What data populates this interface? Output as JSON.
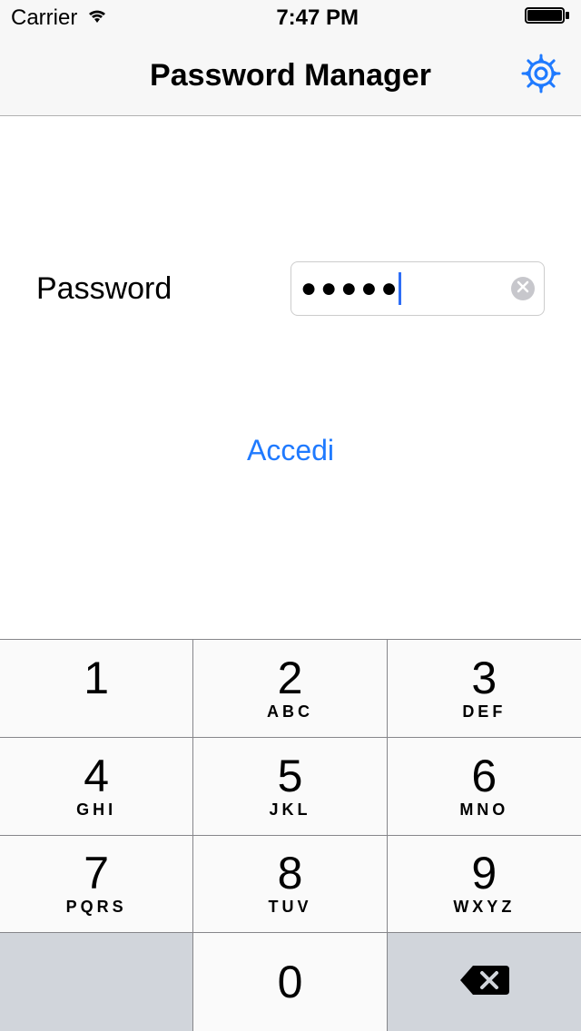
{
  "status_bar": {
    "carrier": "Carrier",
    "time": "7:47 PM"
  },
  "nav": {
    "title": "Password Manager"
  },
  "form": {
    "password_label": "Password",
    "password_value": "●●●●●"
  },
  "actions": {
    "login_label": "Accedi"
  },
  "keypad": {
    "keys": [
      {
        "digit": "1",
        "letters": ""
      },
      {
        "digit": "2",
        "letters": "ABC"
      },
      {
        "digit": "3",
        "letters": "DEF"
      },
      {
        "digit": "4",
        "letters": "GHI"
      },
      {
        "digit": "5",
        "letters": "JKL"
      },
      {
        "digit": "6",
        "letters": "MNO"
      },
      {
        "digit": "7",
        "letters": "PQRS"
      },
      {
        "digit": "8",
        "letters": "TUV"
      },
      {
        "digit": "9",
        "letters": "WXYZ"
      }
    ],
    "zero": "0"
  }
}
